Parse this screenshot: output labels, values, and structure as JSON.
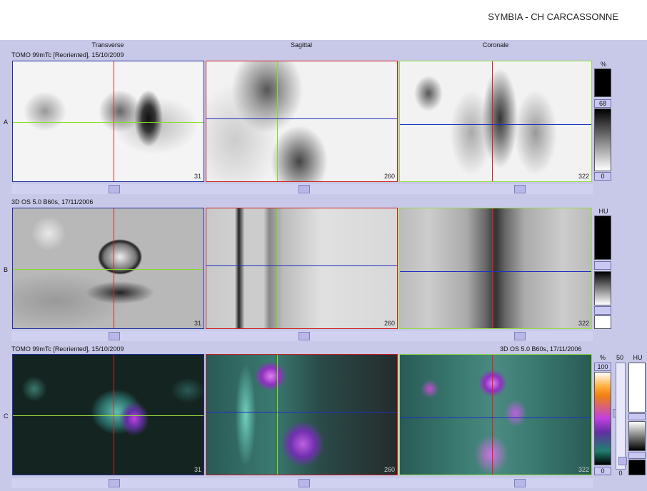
{
  "header": {
    "title": "SYMBIA - CH CARCASSONNE"
  },
  "columns": [
    "Transverse",
    "Sagittal",
    "Coronale"
  ],
  "rows": [
    {
      "label": "A",
      "series": "TOMO 99mTc [Reoriented], 15/10/2009",
      "series_right": ""
    },
    {
      "label": "B",
      "series": "3D  OS  5.0  B60s, 17/11/2006",
      "series_right": ""
    },
    {
      "label": "C",
      "series": "TOMO 99mTc [Reoriented], 15/10/2009",
      "series_right": "3D  OS  5.0  B60s, 17/11/2006"
    }
  ],
  "slices": [
    "31",
    "260",
    "322"
  ],
  "scales": {
    "a": {
      "unit": "%",
      "mid": "68",
      "low": "0"
    },
    "b": {
      "unit": "HU"
    },
    "c": {
      "unit_pct": "%",
      "top_pct": "100",
      "low_pct": "0",
      "mid_val": "50",
      "unit_hu": "HU",
      "low_hu": "0"
    }
  }
}
